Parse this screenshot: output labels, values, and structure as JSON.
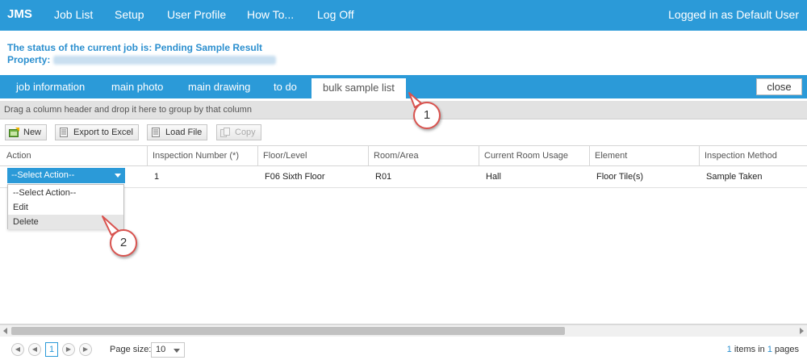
{
  "nav": {
    "brand": "JMS",
    "items": [
      "Job List",
      "Setup",
      "User Profile",
      "How To...",
      "Log Off"
    ],
    "logged_in": "Logged in as Default User"
  },
  "status": {
    "line1": "The status of the current job is: Pending Sample Result",
    "property_label": "Property:"
  },
  "tabs": [
    "job information",
    "main photo",
    "main drawing",
    "to do",
    "bulk sample list"
  ],
  "active_tab": "bulk sample list",
  "close_label": "close",
  "group_hint": "Drag a column header and drop it here to group by that column",
  "toolbar": {
    "new_label": "New",
    "export_label": "Export to Excel",
    "load_label": "Load File",
    "copy_label": "Copy"
  },
  "grid": {
    "columns": [
      "Action",
      "Inspection Number (*)",
      "Floor/Level",
      "Room/Area",
      "Current Room Usage",
      "Element",
      "Inspection Method"
    ],
    "rows": [
      [
        "",
        "1",
        "F06 Sixth Floor",
        "R01",
        "Hall",
        "Floor Tile(s)",
        "Sample Taken"
      ]
    ]
  },
  "action_select": {
    "selected": "--Select Action--",
    "options": [
      "--Select Action--",
      "Edit",
      "Delete"
    ]
  },
  "pager": {
    "current_page": "1",
    "page_size_label": "Page size:",
    "page_size": "10",
    "items_count": "1",
    "items_text": "items in",
    "pages_count": "1",
    "pages_text": "pages"
  },
  "callouts": [
    "1",
    "2"
  ],
  "colors": {
    "primary": "#2b9ad8",
    "callout_border": "#d9534f"
  }
}
